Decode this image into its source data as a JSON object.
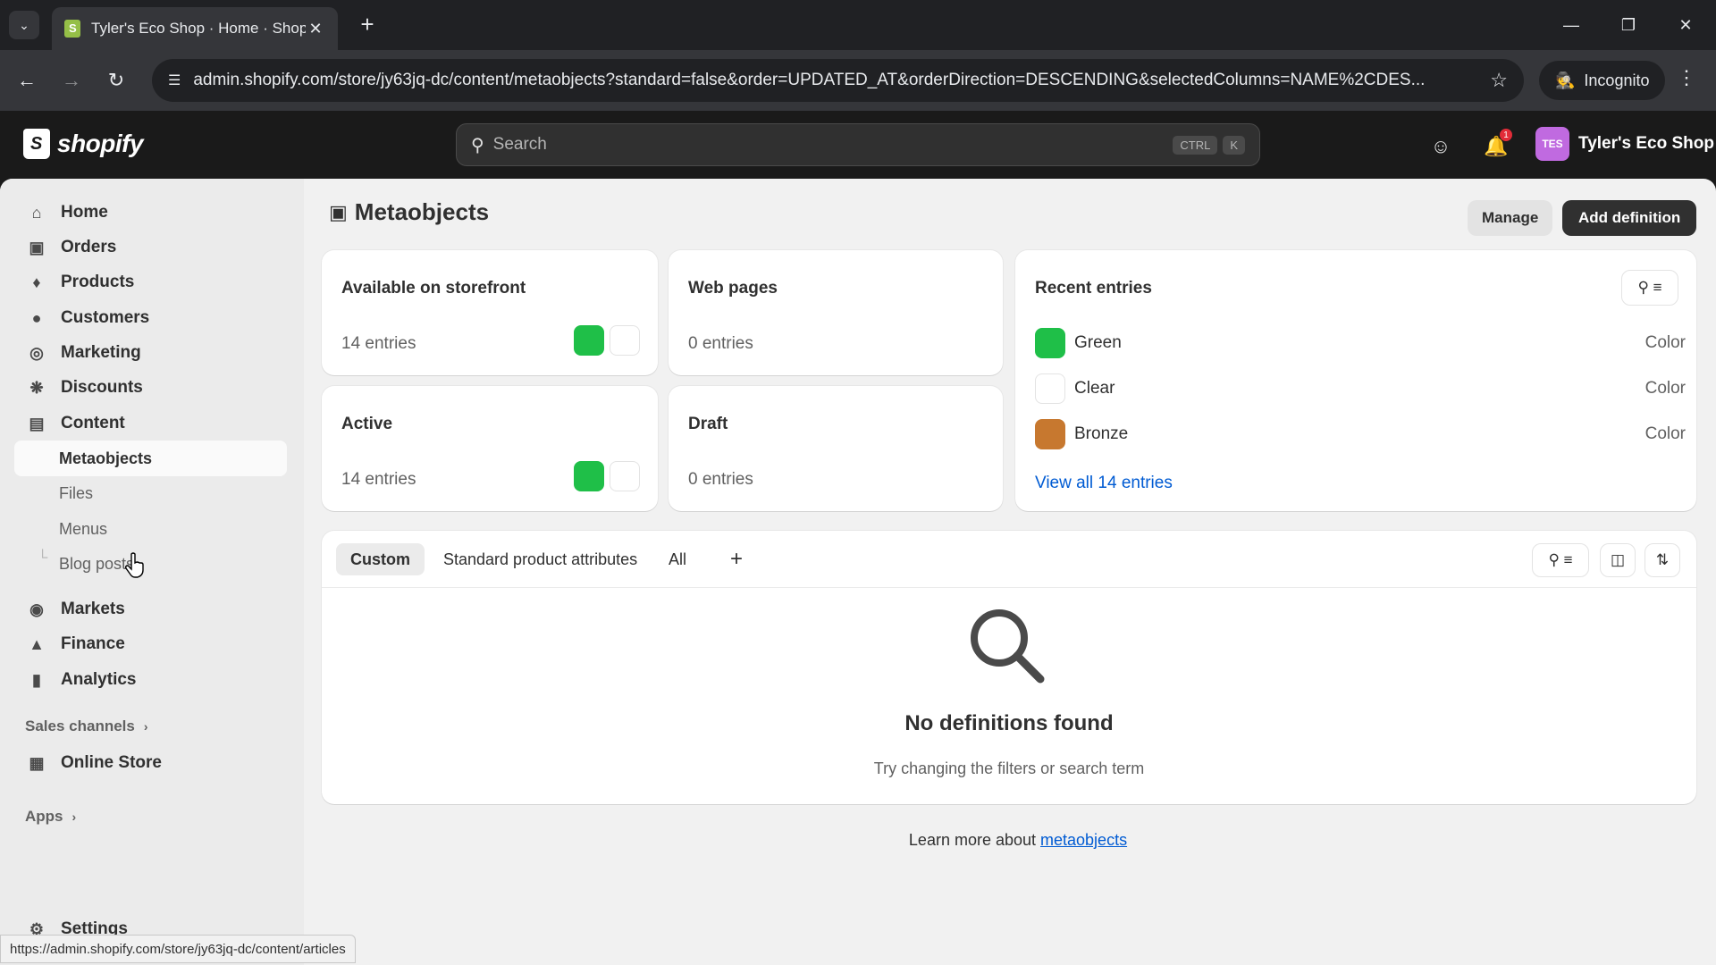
{
  "browser": {
    "tab_title": "Tyler's Eco Shop · Home · Shopi",
    "url": "admin.shopify.com/store/jy63jq-dc/content/metaobjects?standard=false&order=UPDATED_AT&orderDirection=DESCENDING&selectedColumns=NAME%2CDES...",
    "incognito_label": "Incognito",
    "status_url": "https://admin.shopify.com/store/jy63jq-dc/content/articles"
  },
  "topbar": {
    "logo_text": "shopify",
    "search_placeholder": "Search",
    "kbd_ctrl": "CTRL",
    "kbd_k": "K",
    "notification_count": "1",
    "store_initials": "TES",
    "store_name": "Tyler's Eco Shop"
  },
  "sidebar": {
    "items": [
      {
        "label": "Home",
        "icon": "home-icon"
      },
      {
        "label": "Orders",
        "icon": "inbox-icon"
      },
      {
        "label": "Products",
        "icon": "tag-icon"
      },
      {
        "label": "Customers",
        "icon": "person-icon"
      },
      {
        "label": "Marketing",
        "icon": "target-icon"
      },
      {
        "label": "Discounts",
        "icon": "discount-icon"
      },
      {
        "label": "Content",
        "icon": "content-icon"
      }
    ],
    "content_sub": [
      "Metaobjects",
      "Files",
      "Menus",
      "Blog posts"
    ],
    "items2": [
      {
        "label": "Markets",
        "icon": "globe-icon"
      },
      {
        "label": "Finance",
        "icon": "bank-icon"
      },
      {
        "label": "Analytics",
        "icon": "chart-icon"
      }
    ],
    "sales_channels": "Sales channels",
    "online_store": "Online Store",
    "apps": "Apps",
    "settings": "Settings"
  },
  "page": {
    "title": "Metaobjects",
    "manage_label": "Manage",
    "add_definition_label": "Add definition"
  },
  "stats": {
    "storefront": {
      "title": "Available on storefront",
      "count": "14 entries"
    },
    "webpages": {
      "title": "Web pages",
      "count": "0 entries"
    },
    "active": {
      "title": "Active",
      "count": "14 entries"
    },
    "draft": {
      "title": "Draft",
      "count": "0 entries"
    }
  },
  "recent": {
    "title": "Recent entries",
    "entries": [
      {
        "name": "Green",
        "type": "Color",
        "color": "#1fbf48"
      },
      {
        "name": "Clear",
        "type": "Color",
        "color": "#ffffff"
      },
      {
        "name": "Bronze",
        "type": "Color",
        "color": "#c7782f"
      }
    ],
    "view_all": "View all 14 entries"
  },
  "definitions": {
    "tabs": [
      "Custom",
      "Standard product attributes",
      "All"
    ],
    "active_tab": "Custom",
    "empty_title": "No definitions found",
    "empty_subtitle": "Try changing the filters or search term"
  },
  "footer": {
    "learn_prefix": "Learn more about ",
    "learn_link": "metaobjects"
  },
  "colors": {
    "green_swatch": "#1fbf48",
    "accent_link": "#005bd3",
    "primary_button": "#303030"
  }
}
